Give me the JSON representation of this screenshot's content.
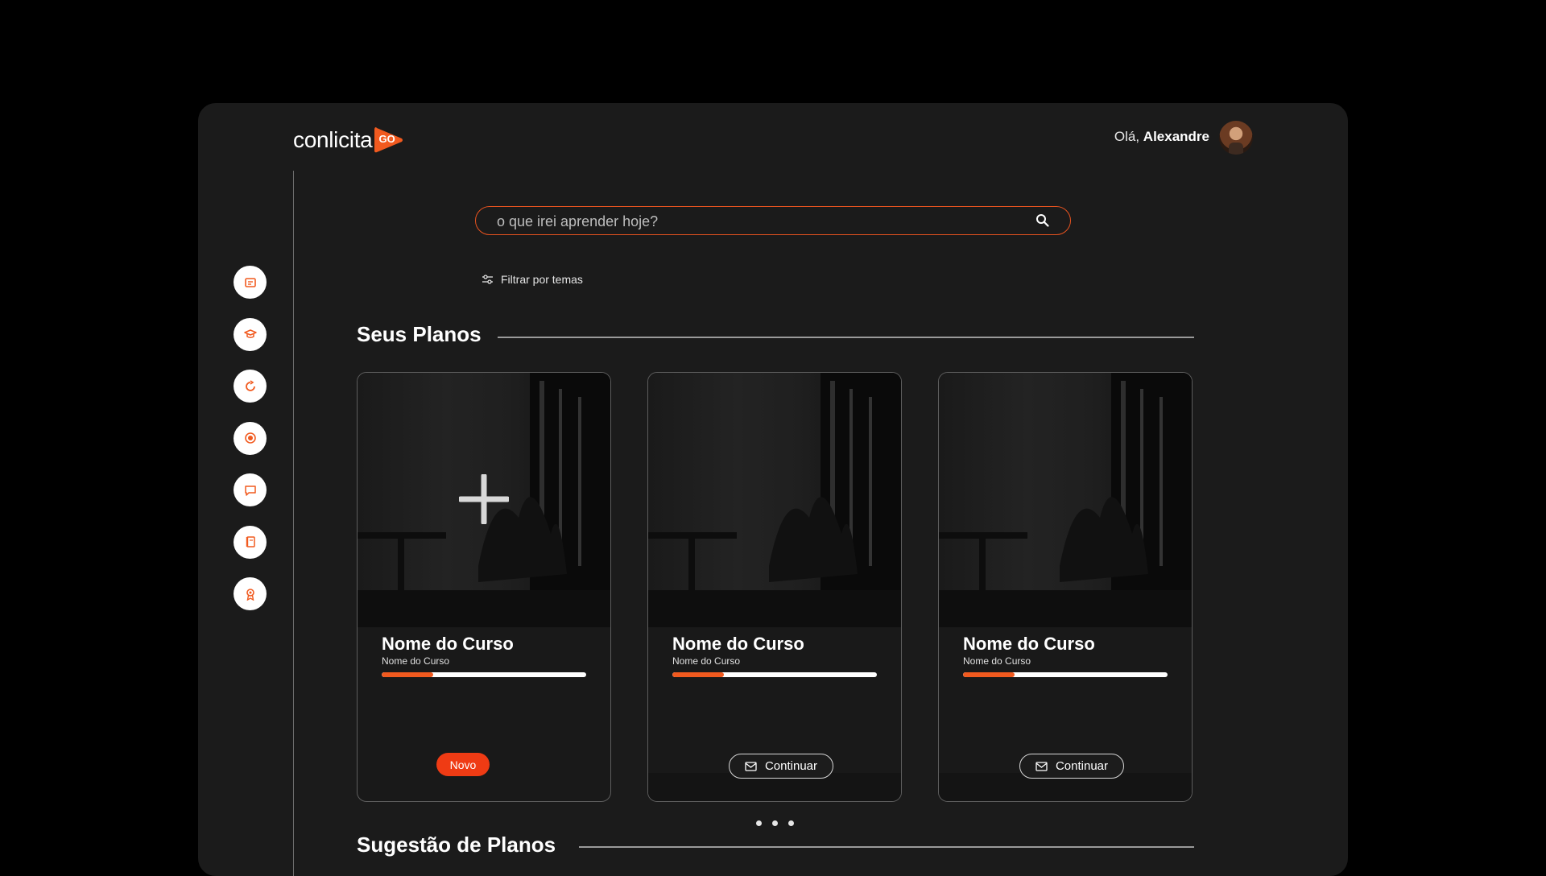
{
  "brand": {
    "name": "conlicita",
    "badge": "GO",
    "accent": "#f15a1f"
  },
  "header": {
    "greeting_prefix": "Olá,",
    "user_name": "Alexandre"
  },
  "sidebar": {
    "items": [
      {
        "icon": "news-icon"
      },
      {
        "icon": "graduation-cap-icon"
      },
      {
        "icon": "refresh-icon"
      },
      {
        "icon": "target-icon"
      },
      {
        "icon": "chat-icon"
      },
      {
        "icon": "book-icon"
      },
      {
        "icon": "award-icon"
      }
    ]
  },
  "search": {
    "placeholder": "o que irei aprender hoje?",
    "value": ""
  },
  "filter": {
    "label": "Filtrar por temas"
  },
  "sections": {
    "my_plans": "Seus Planos",
    "suggestions": "Sugestão de Planos"
  },
  "cards": [
    {
      "title": "Nome do Curso",
      "subtitle": "Nome do Curso",
      "progress": 0.25,
      "action": "Novo",
      "type": "new"
    },
    {
      "title": "Nome do Curso",
      "subtitle": "Nome do Curso",
      "progress": 0.25,
      "action": "Continuar",
      "type": "continue"
    },
    {
      "title": "Nome do Curso",
      "subtitle": "Nome do Curso",
      "progress": 0.25,
      "action": "Continuar",
      "type": "continue"
    }
  ],
  "carousel": {
    "pages": 3
  }
}
